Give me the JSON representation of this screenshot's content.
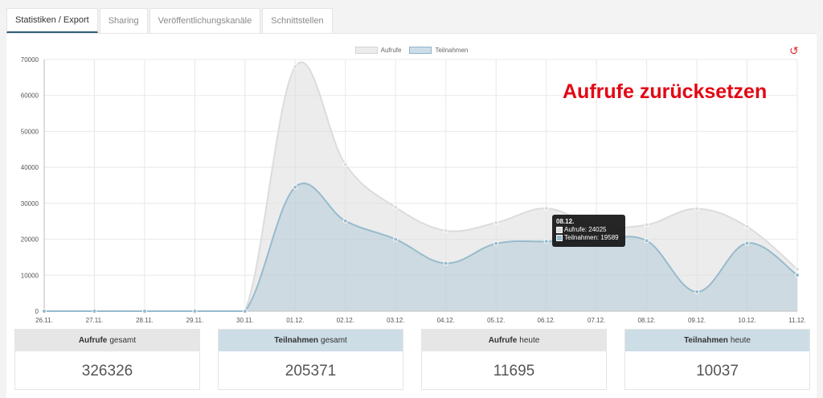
{
  "tabs": [
    {
      "label": "Statistiken / Export",
      "active": true
    },
    {
      "label": "Sharing",
      "active": false
    },
    {
      "label": "Veröffentlichungskanäle",
      "active": false
    },
    {
      "label": "Schnittstellen",
      "active": false
    }
  ],
  "annotation": "Aufrufe zurücksetzen",
  "reset_icon": "reset-icon",
  "chart_data": {
    "type": "area",
    "categories": [
      "26.11.",
      "27.11.",
      "28.11.",
      "29.11.",
      "30.11.",
      "01.12.",
      "02.12.",
      "03.12.",
      "04.12.",
      "05.12.",
      "06.12.",
      "07.12.",
      "08.12.",
      "09.12.",
      "10.12.",
      "11.12."
    ],
    "series": [
      {
        "name": "Aufrufe",
        "color": "#dcdcdc",
        "values": [
          0,
          0,
          0,
          0,
          0,
          68000,
          40800,
          28900,
          22400,
          24600,
          28600,
          23800,
          24025,
          28500,
          23500,
          11695
        ]
      },
      {
        "name": "Teilnahmen",
        "color": "#97bbcd",
        "values": [
          0,
          0,
          0,
          0,
          0,
          34500,
          25100,
          20000,
          13300,
          18800,
          19400,
          19600,
          19589,
          5400,
          18900,
          10037
        ]
      }
    ],
    "yticks": [
      "0",
      "10000",
      "20000",
      "30000",
      "40000",
      "50000",
      "60000",
      "70000"
    ],
    "ylim": [
      0,
      70000
    ],
    "legend": "top"
  },
  "tooltip": {
    "title": "08.12.",
    "line1": "Aufrufe: 24025",
    "line2": "Teilnahmen: 19589"
  },
  "cards": [
    {
      "bold": "Aufrufe",
      "rest": "gesamt",
      "value": "326326",
      "style": "gray"
    },
    {
      "bold": "Teilnahmen",
      "rest": "gesamt",
      "value": "205371",
      "style": "blue"
    },
    {
      "bold": "Aufrufe",
      "rest": "heute",
      "value": "11695",
      "style": "gray"
    },
    {
      "bold": "Teilnahmen",
      "rest": "heute",
      "value": "10037",
      "style": "blue"
    }
  ]
}
